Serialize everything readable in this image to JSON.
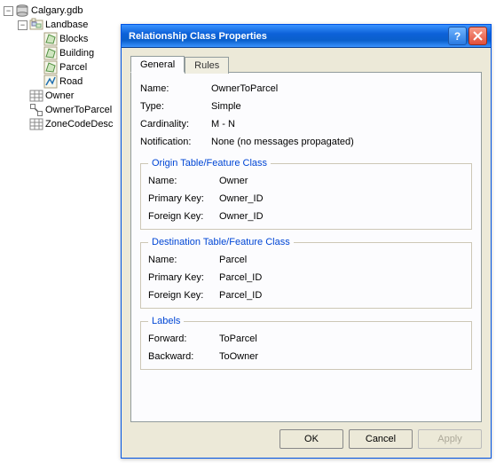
{
  "tree": {
    "root": {
      "label": "Calgary.gdb"
    },
    "dataset": {
      "label": "Landbase"
    },
    "fc": [
      {
        "label": "Blocks"
      },
      {
        "label": "Building"
      },
      {
        "label": "Parcel"
      },
      {
        "label": "Road"
      }
    ],
    "table": {
      "label": "Owner"
    },
    "rel": {
      "label": "OwnerToParcel"
    },
    "domain": {
      "label": "ZoneCodeDesc"
    }
  },
  "dialog": {
    "title": "Relationship Class Properties",
    "tabs": {
      "general": "General",
      "rules": "Rules"
    },
    "fields": {
      "name_k": "Name:",
      "name_v": "OwnerToParcel",
      "type_k": "Type:",
      "type_v": "Simple",
      "card_k": "Cardinality:",
      "card_v": "M - N",
      "notif_k": "Notification:",
      "notif_v": "None (no messages propagated)"
    },
    "origin": {
      "legend": "Origin Table/Feature Class",
      "name_k": "Name:",
      "name_v": "Owner",
      "pk_k": "Primary Key:",
      "pk_v": "Owner_ID",
      "fk_k": "Foreign Key:",
      "fk_v": "Owner_ID"
    },
    "dest": {
      "legend": "Destination Table/Feature Class",
      "name_k": "Name:",
      "name_v": "Parcel",
      "pk_k": "Primary Key:",
      "pk_v": "Parcel_ID",
      "fk_k": "Foreign Key:",
      "fk_v": "Parcel_ID"
    },
    "labels": {
      "legend": "Labels",
      "fwd_k": "Forward:",
      "fwd_v": "ToParcel",
      "bwd_k": "Backward:",
      "bwd_v": "ToOwner"
    },
    "buttons": {
      "ok": "OK",
      "cancel": "Cancel",
      "apply": "Apply"
    }
  }
}
